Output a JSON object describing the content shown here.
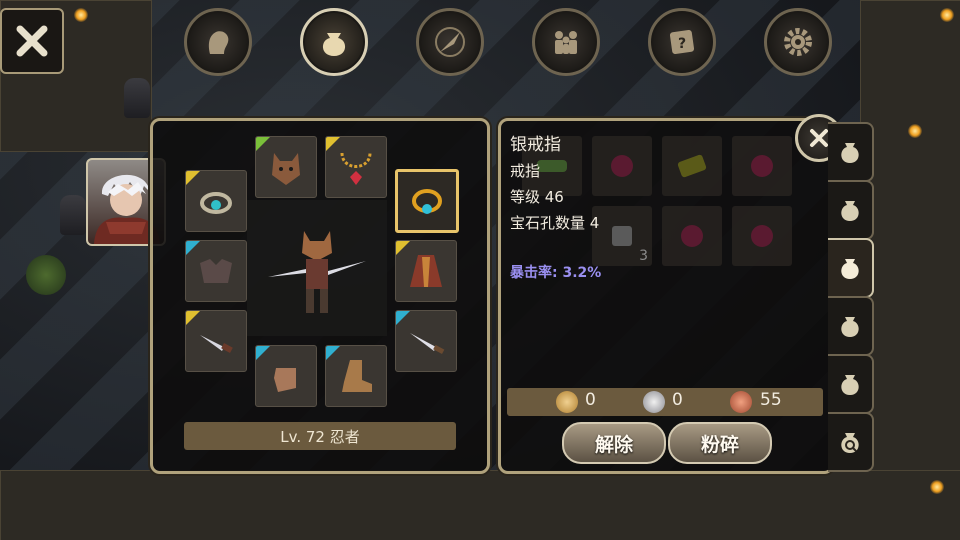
{
  "top_tabs": [
    {
      "name": "character",
      "icon": "head-icon"
    },
    {
      "name": "inventory",
      "icon": "bag-icon",
      "active": true
    },
    {
      "name": "skills",
      "icon": "compass-icon"
    },
    {
      "name": "party",
      "icon": "people-icon"
    },
    {
      "name": "quests",
      "icon": "scroll-icon"
    },
    {
      "name": "settings",
      "icon": "gear-icon"
    }
  ],
  "equipment": {
    "level_label": "Lv. 72 忍者",
    "slots": [
      {
        "slot": "ring-left",
        "icon": "ring-icon",
        "rarity_color": "#e0c030"
      },
      {
        "slot": "head",
        "icon": "wolf-helmet-icon",
        "rarity_color": "#7ac03a"
      },
      {
        "slot": "necklace",
        "icon": "necklace-icon",
        "rarity_color": "#e0c030"
      },
      {
        "slot": "ring-right",
        "icon": "gold-ring-icon",
        "rarity_color": "",
        "selected": true
      },
      {
        "slot": "shoulder",
        "icon": "armor-icon",
        "rarity_color": "#30b0d0"
      },
      {
        "slot": "cloak",
        "icon": "cloak-icon",
        "rarity_color": "#e0c030"
      },
      {
        "slot": "weapon-left",
        "icon": "dagger-icon",
        "rarity_color": "#e0c030"
      },
      {
        "slot": "weapon-right",
        "icon": "knife-icon",
        "rarity_color": "#30b0d0"
      },
      {
        "slot": "gloves",
        "icon": "glove-icon",
        "rarity_color": "#30b0d0"
      },
      {
        "slot": "boots",
        "icon": "boot-icon",
        "rarity_color": "#30b0d0"
      }
    ]
  },
  "item_detail": {
    "name": "银戒指",
    "type": "戒指",
    "level": "等级 46",
    "gem_slots": "宝石孔数量 4",
    "stat": "暴击率: 3.2%",
    "stack_count": "3"
  },
  "currency": {
    "gold": "0",
    "silver": "0",
    "copper": "55"
  },
  "buttons": {
    "unequip": "解除",
    "smash": "粉碎"
  },
  "colors": {
    "frame": "#b0a27c",
    "crit_text": "#9a8ff0",
    "selected_border": "#e8c46a",
    "bar": "#6b5a3e"
  }
}
